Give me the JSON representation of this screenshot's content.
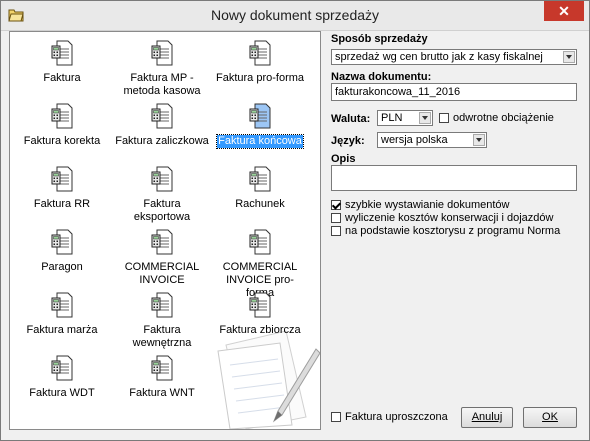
{
  "window": {
    "title": "Nowy dokument sprzedaży",
    "close_symbol": "✕"
  },
  "documents": [
    {
      "label": "Faktura",
      "icon": "calculator-document-icon"
    },
    {
      "label": "Faktura MP - metoda kasowa",
      "icon": "calculator-document-icon"
    },
    {
      "label": "Faktura pro-forma",
      "icon": "calculator-document-icon"
    },
    {
      "label": "Faktura korekta",
      "icon": "calculator-document-icon"
    },
    {
      "label": "Faktura zaliczkowa",
      "icon": "calculator-document-icon"
    },
    {
      "label": "Faktura końcowa",
      "icon": "calculator-document-icon",
      "selected": true
    },
    {
      "label": "Faktura RR",
      "icon": "calculator-document-icon"
    },
    {
      "label": "Faktura eksportowa",
      "icon": "calculator-document-icon"
    },
    {
      "label": "Rachunek",
      "icon": "calculator-document-icon"
    },
    {
      "label": "Paragon",
      "icon": "calculator-document-icon"
    },
    {
      "label": "COMMERCIAL INVOICE",
      "icon": "calculator-document-icon"
    },
    {
      "label": "COMMERCIAL INVOICE pro-forma",
      "icon": "calculator-document-icon"
    },
    {
      "label": "Faktura marża",
      "icon": "calculator-document-icon"
    },
    {
      "label": "Faktura wewnętrzna",
      "icon": "calculator-document-icon"
    },
    {
      "label": "Faktura zbiorcza",
      "icon": "calculator-document-icon"
    },
    {
      "label": "Faktura WDT",
      "icon": "calculator-document-icon"
    },
    {
      "label": "Faktura WNT",
      "icon": "calculator-document-icon"
    }
  ],
  "form": {
    "sales_method_label": "Sposób sprzedaży",
    "sales_method_value": "sprzedaż wg cen brutto jak z kasy fiskalnej",
    "doc_name_label": "Nazwa dokumentu:",
    "doc_name_value": "fakturakoncowa_11_2016",
    "currency_label": "Waluta:",
    "currency_value": "PLN",
    "reverse_charge_label": "odwrotne obciążenie",
    "reverse_charge_checked": false,
    "language_label": "Język:",
    "language_value": "wersja polska",
    "description_label": "Opis",
    "description_value": "",
    "options": [
      {
        "label": "szybkie wystawianie dokumentów",
        "checked": true
      },
      {
        "label": "wyliczenie kosztów konserwacji i dojazdów",
        "checked": false
      },
      {
        "label": "na podstawie kosztorysu z programu Norma",
        "checked": false
      }
    ],
    "simplified_label": "Faktura uproszczona",
    "simplified_checked": false
  },
  "buttons": {
    "cancel": "Anuluj",
    "ok": "OK"
  },
  "colors": {
    "selection": "#3399ff",
    "close": "#c7382b"
  }
}
